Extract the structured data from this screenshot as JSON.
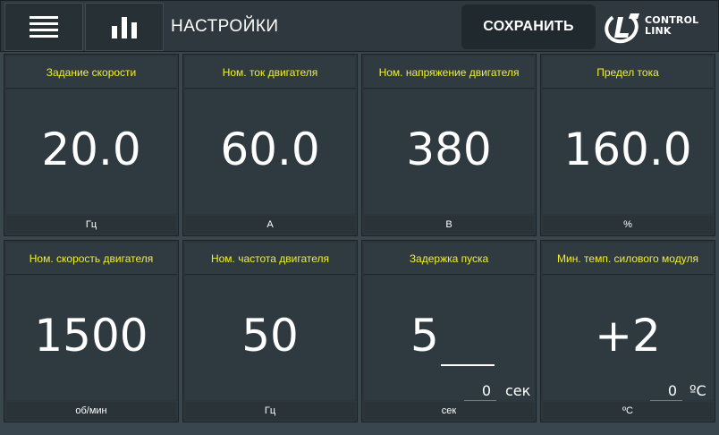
{
  "header": {
    "title": "НАСТРОЙКИ",
    "save_label": "СОХРАНИТЬ",
    "logo": {
      "line1": "CONTROL",
      "line2": "LINK"
    }
  },
  "cards": [
    {
      "title": "Задание скорости",
      "value": "20.0",
      "unit": "Гц"
    },
    {
      "title": "Ном. ток двигателя",
      "value": "60.0",
      "unit": "А"
    },
    {
      "title": "Ном. напряжение двигателя",
      "value": "380",
      "unit": "В"
    },
    {
      "title": "Предел тока",
      "value": "160.0",
      "unit": "%"
    },
    {
      "title": "Ном. скорость двигателя",
      "value": "1500",
      "unit": "об/мин"
    },
    {
      "title": "Ном. частота двигателя",
      "value": "50",
      "unit": "Гц"
    },
    {
      "title": "Задержка пуска",
      "value": "5",
      "unit": "сек",
      "input_value": "0",
      "input_unit": "сек"
    },
    {
      "title": "Мин. темп. силового модуля",
      "value": "+2",
      "unit": "ºC",
      "input_value": "0",
      "input_unit": "ºC"
    }
  ],
  "colors": {
    "accent_title": "#f2ef2a",
    "background": "#3a464d",
    "card": "#2c363c"
  }
}
